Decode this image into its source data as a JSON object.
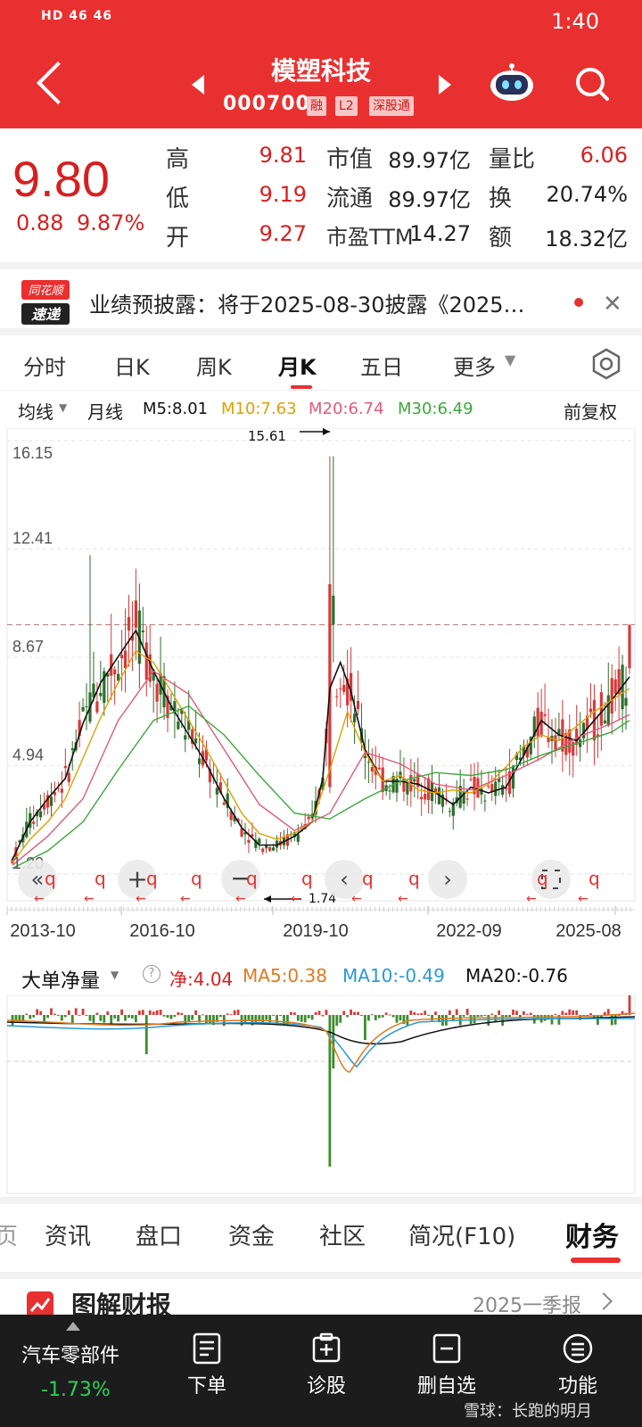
{
  "status": {
    "left": "HD  46  46",
    "time": "1:40"
  },
  "header": {
    "name": "模塑科技",
    "code": "000700",
    "tags": [
      "融",
      "L2",
      "深股通"
    ]
  },
  "quote": {
    "price": "9.80",
    "change": "0.88",
    "pct": "9.87%",
    "rows": [
      {
        "l1": "高",
        "v1": "9.81",
        "l2": "市值",
        "v2": "89.97亿",
        "l3": "量比",
        "v3": "6.06"
      },
      {
        "l1": "低",
        "v1": "9.19",
        "l2": "流通",
        "v2": "89.97亿",
        "l3": "换",
        "v3": "20.74%"
      },
      {
        "l1": "开",
        "v1": "9.27",
        "l2": "市盈TTM",
        "v2": "14.27",
        "l3": "额",
        "v3": "18.32亿"
      }
    ]
  },
  "notice": {
    "text": "业绩预披露：将于2025-08-30披露《2025…",
    "logo_top": "同花顺",
    "logo_bottom": "速递"
  },
  "ktabs": [
    "分时",
    "日K",
    "周K",
    "月K",
    "五日",
    "更多"
  ],
  "maline": {
    "type": "均线",
    "period": "月线",
    "m5": "M5:8.01",
    "m10": "M10:7.63",
    "m20": "M20:6.74",
    "m30": "M30:6.49",
    "adj": "前复权",
    "colors": {
      "m5": "#111111",
      "m10": "#e0a000",
      "m20": "#e05a7a",
      "m30": "#3aa83a"
    }
  },
  "chart_data": {
    "type": "candlestick",
    "y_ticks": [
      "16.15",
      "12.41",
      "8.67",
      "4.94",
      "1.20"
    ],
    "ylim": [
      1.2,
      16.15
    ],
    "x_ticks": [
      "2013-10",
      "2016-10",
      "2019-10",
      "2022-09",
      "2025-08"
    ],
    "high_label": "15.61",
    "low_label": "1.74",
    "series": [
      {
        "name": "M5",
        "points": [
          [
            0,
            1.7
          ],
          [
            5,
            3.0
          ],
          [
            10,
            3.8
          ],
          [
            15,
            4.5
          ],
          [
            20,
            6.4
          ],
          [
            25,
            7.8
          ],
          [
            30,
            8.7
          ],
          [
            35,
            9.6
          ],
          [
            40,
            8.2
          ],
          [
            45,
            7.0
          ],
          [
            50,
            6.0
          ],
          [
            55,
            5.0
          ],
          [
            60,
            3.8
          ],
          [
            65,
            2.8
          ],
          [
            70,
            2.2
          ],
          [
            75,
            2.2
          ],
          [
            80,
            2.5
          ],
          [
            85,
            3.0
          ],
          [
            88,
            4.5
          ],
          [
            90,
            7.6
          ],
          [
            93,
            8.5
          ],
          [
            96,
            7.5
          ],
          [
            100,
            5.5
          ],
          [
            105,
            4.4
          ],
          [
            110,
            4.4
          ],
          [
            115,
            4.3
          ],
          [
            120,
            4.0
          ],
          [
            125,
            3.6
          ],
          [
            130,
            4.2
          ],
          [
            135,
            4.0
          ],
          [
            140,
            4.2
          ],
          [
            145,
            5.3
          ],
          [
            150,
            6.5
          ],
          [
            155,
            6.0
          ],
          [
            160,
            5.8
          ],
          [
            165,
            6.5
          ],
          [
            170,
            7.2
          ],
          [
            175,
            8.0
          ]
        ]
      },
      {
        "name": "M10",
        "points": [
          [
            0,
            1.6
          ],
          [
            5,
            2.4
          ],
          [
            10,
            3.0
          ],
          [
            15,
            3.8
          ],
          [
            20,
            5.2
          ],
          [
            25,
            6.6
          ],
          [
            30,
            7.8
          ],
          [
            35,
            8.9
          ],
          [
            40,
            8.5
          ],
          [
            45,
            7.5
          ],
          [
            50,
            6.5
          ],
          [
            55,
            5.5
          ],
          [
            60,
            4.4
          ],
          [
            65,
            3.3
          ],
          [
            70,
            2.6
          ],
          [
            75,
            2.4
          ],
          [
            80,
            2.6
          ],
          [
            85,
            3.0
          ],
          [
            90,
            4.8
          ],
          [
            95,
            6.8
          ],
          [
            100,
            5.4
          ],
          [
            105,
            4.4
          ],
          [
            110,
            4.6
          ],
          [
            115,
            4.1
          ],
          [
            120,
            4.0
          ],
          [
            125,
            4.1
          ],
          [
            130,
            4.0
          ],
          [
            135,
            4.3
          ],
          [
            140,
            4.9
          ],
          [
            145,
            5.6
          ],
          [
            150,
            6.0
          ],
          [
            155,
            5.8
          ],
          [
            160,
            6.3
          ],
          [
            165,
            6.8
          ],
          [
            170,
            7.2
          ],
          [
            175,
            7.6
          ]
        ]
      },
      {
        "name": "M20",
        "points": [
          [
            0,
            1.5
          ],
          [
            10,
            2.5
          ],
          [
            20,
            3.8
          ],
          [
            30,
            6.5
          ],
          [
            40,
            8.2
          ],
          [
            50,
            7.4
          ],
          [
            60,
            5.5
          ],
          [
            70,
            3.6
          ],
          [
            80,
            2.7
          ],
          [
            90,
            3.3
          ],
          [
            100,
            5.4
          ],
          [
            110,
            5.0
          ],
          [
            120,
            4.3
          ],
          [
            130,
            4.1
          ],
          [
            140,
            4.6
          ],
          [
            150,
            5.2
          ],
          [
            160,
            5.9
          ],
          [
            170,
            6.4
          ],
          [
            175,
            6.7
          ]
        ]
      },
      {
        "name": "M30",
        "points": [
          [
            0,
            1.4
          ],
          [
            10,
            2.0
          ],
          [
            20,
            3.0
          ],
          [
            30,
            4.8
          ],
          [
            40,
            6.5
          ],
          [
            50,
            7.0
          ],
          [
            60,
            6.0
          ],
          [
            70,
            4.6
          ],
          [
            80,
            3.3
          ],
          [
            90,
            3.1
          ],
          [
            100,
            3.8
          ],
          [
            110,
            4.4
          ],
          [
            120,
            4.7
          ],
          [
            130,
            4.6
          ],
          [
            140,
            4.8
          ],
          [
            150,
            5.3
          ],
          [
            160,
            5.7
          ],
          [
            170,
            6.1
          ],
          [
            175,
            6.5
          ]
        ]
      }
    ]
  },
  "flow": {
    "label": "大单净量",
    "net": "净:4.04",
    "ma5": "MA5:0.38",
    "ma10": "MA10:-0.49",
    "ma20": "MA20:-0.76"
  },
  "btabs": [
    "资讯",
    "盘口",
    "资金",
    "社区",
    "简况(F10)",
    "财务"
  ],
  "report": {
    "title": "图解财报",
    "period": "2025一季报"
  },
  "bottom": {
    "sector": "汽车零部件",
    "sector_chg": "-1.73%",
    "items": [
      "下单",
      "诊股",
      "删自选",
      "功能"
    ],
    "watermark": "雪球：长跑的明月"
  }
}
